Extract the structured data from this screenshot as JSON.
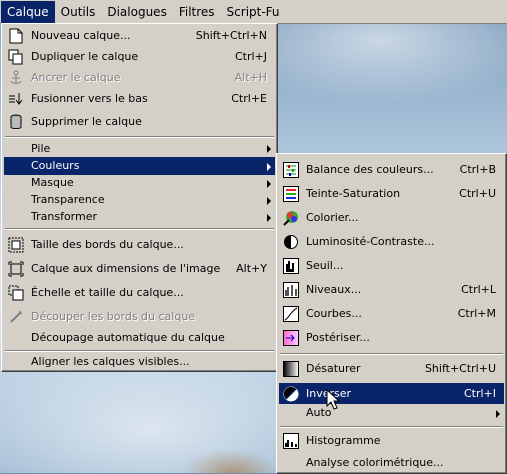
{
  "menubar": {
    "items": [
      "Calque",
      "Outils",
      "Dialogues",
      "Filtres",
      "Script-Fu"
    ],
    "active": "Calque"
  },
  "layer_menu": {
    "items": [
      {
        "label": "Nouveau calque...",
        "shortcut": "Shift+Ctrl+N",
        "icon": "new-layer-icon",
        "enabled": true
      },
      {
        "label": "Dupliquer le calque",
        "shortcut": "Ctrl+J",
        "icon": "duplicate-layer-icon",
        "enabled": true
      },
      {
        "label": "Ancrer le calque",
        "shortcut": "Alt+H",
        "icon": "anchor-icon",
        "enabled": false
      },
      {
        "label": "Fusionner vers le bas",
        "shortcut": "Ctrl+E",
        "icon": "merge-down-icon",
        "enabled": true
      },
      {
        "label": "Supprimer le calque",
        "shortcut": "",
        "icon": "delete-layer-icon",
        "enabled": true
      },
      {
        "label": "Pile",
        "submenu": true
      },
      {
        "label": "Couleurs",
        "submenu": true,
        "highlighted": true
      },
      {
        "label": "Masque",
        "submenu": true
      },
      {
        "label": "Transparence",
        "submenu": true
      },
      {
        "label": "Transformer",
        "submenu": true
      },
      {
        "label": "Taille des bords du calque...",
        "shortcut": "",
        "icon": "layer-boundary-size-icon",
        "enabled": true
      },
      {
        "label": "Calque aux dimensions de l'image",
        "shortcut": "Alt+Y",
        "icon": "layer-to-image-size-icon",
        "enabled": true
      },
      {
        "label": "Échelle et taille du calque...",
        "shortcut": "",
        "icon": "scale-layer-icon",
        "enabled": true
      },
      {
        "label": "Découper les bords du calque",
        "shortcut": "",
        "icon": "crop-icon",
        "enabled": false
      },
      {
        "label": "Découpage automatique du calque",
        "shortcut": "",
        "enabled": true
      },
      {
        "label": "Aligner les calques visibles...",
        "shortcut": "",
        "enabled": true
      }
    ]
  },
  "colors_menu": {
    "items": [
      {
        "label": "Balance des couleurs...",
        "shortcut": "Ctrl+B",
        "icon": "color-balance-icon"
      },
      {
        "label": "Teinte-Saturation",
        "shortcut": "Ctrl+U",
        "icon": "hue-saturation-icon"
      },
      {
        "label": "Colorier...",
        "shortcut": "",
        "icon": "colorize-icon"
      },
      {
        "label": "Luminosité-Contraste...",
        "shortcut": "",
        "icon": "brightness-contrast-icon"
      },
      {
        "label": "Seuil...",
        "shortcut": "",
        "icon": "threshold-icon"
      },
      {
        "label": "Niveaux...",
        "shortcut": "Ctrl+L",
        "icon": "levels-icon"
      },
      {
        "label": "Courbes...",
        "shortcut": "Ctrl+M",
        "icon": "curves-icon"
      },
      {
        "label": "Postériser...",
        "shortcut": "",
        "icon": "posterize-icon"
      },
      {
        "label": "Désaturer",
        "shortcut": "Shift+Ctrl+U",
        "icon": "desaturate-icon"
      },
      {
        "label": "Inverser",
        "shortcut": "Ctrl+I",
        "icon": "invert-icon",
        "highlighted": true
      },
      {
        "label": "Auto",
        "submenu": true
      },
      {
        "label": "Histogramme",
        "shortcut": "",
        "icon": "histogram-icon"
      },
      {
        "label": "Analyse colorimétrique...",
        "shortcut": ""
      }
    ]
  },
  "colors": {
    "highlight": "#0a246a",
    "menu_bg": "#d4d0c8",
    "disabled": "#808080"
  }
}
